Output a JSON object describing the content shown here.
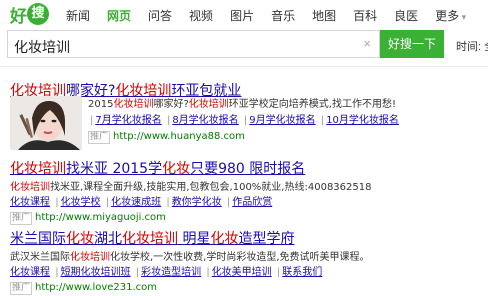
{
  "logo": {
    "text": "好",
    "badge": "搜"
  },
  "nav": [
    "新闻",
    "网页",
    "问答",
    "视频",
    "图片",
    "音乐",
    "地图",
    "百科",
    "良医",
    "更多"
  ],
  "nav_active_index": 1,
  "search": {
    "query": "化妆培训",
    "clear": "×",
    "button": "好搜一下",
    "time_label": "时间: 全"
  },
  "results": [
    {
      "title": [
        "化妆培训",
        "哪家好?",
        "化妆培训",
        "环亚包就业"
      ],
      "desc": [
        "2015",
        "化妆培训",
        "哪家好?",
        "化妆培训",
        "环亚学校定向培养模式,找工作不用愁!"
      ],
      "links": [
        "7月学化妆报名",
        "8月学化妆报名",
        "9月学化妆报名",
        "10月学化妆报名"
      ],
      "ad": "推广",
      "url": "http://www.huanya88.com"
    },
    {
      "title": [
        "化妆培训",
        "找米亚 2015学",
        "化妆",
        "只要980 限时报名"
      ],
      "desc": [
        "化妆培训",
        "找米亚,课程全面升级,技能实用,包教包会,100%就业,热线:4008362518"
      ],
      "links": [
        "化妆课程",
        "化妆学校",
        "化妆速成班",
        "教你学化妆",
        "作品欣赏"
      ],
      "ad": "推广",
      "url": "http://www.miyaguoji.com"
    },
    {
      "title": [
        "米兰国际",
        "化妆",
        "湖北",
        "化妆培训",
        " 明星",
        "化妆",
        "造型学府"
      ],
      "desc": [
        "武汉米兰国际",
        "化妆培训",
        "化妆学校,一次性收费,学时尚彩妆造型,免费试听美甲课程。"
      ],
      "links": [
        "化妆课程",
        "短期化妆培训班",
        "彩妆造型培训",
        "化妆美甲培训",
        "联系我们"
      ],
      "ad": "推广",
      "url": "http://www.love231.com"
    }
  ],
  "colors": {
    "brand": "#3ab034",
    "link": "#1a0dab",
    "highlight": "#d60000",
    "url": "#008000"
  }
}
